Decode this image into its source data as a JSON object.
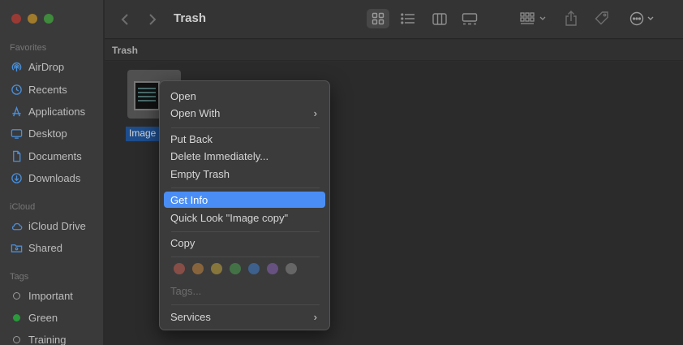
{
  "window": {
    "title": "Trash",
    "path_label": "Trash"
  },
  "sidebar": {
    "sections": [
      {
        "label": "Favorites"
      },
      {
        "label": "iCloud"
      },
      {
        "label": "Tags"
      }
    ],
    "favorites": [
      {
        "label": "AirDrop",
        "icon": "airdrop-icon"
      },
      {
        "label": "Recents",
        "icon": "clock-icon"
      },
      {
        "label": "Applications",
        "icon": "applications-icon"
      },
      {
        "label": "Desktop",
        "icon": "desktop-icon"
      },
      {
        "label": "Documents",
        "icon": "document-icon"
      },
      {
        "label": "Downloads",
        "icon": "download-icon"
      }
    ],
    "icloud": [
      {
        "label": "iCloud Drive",
        "icon": "cloud-icon"
      },
      {
        "label": "Shared",
        "icon": "shared-folder-icon"
      }
    ],
    "tags": [
      {
        "label": "Important",
        "color": "none"
      },
      {
        "label": "Green",
        "color": "#2a9a3a"
      },
      {
        "label": "Training",
        "color": "none"
      }
    ]
  },
  "file": {
    "name": "Image"
  },
  "context_menu": {
    "items": [
      {
        "label": "Open"
      },
      {
        "label": "Open With",
        "submenu": "›"
      },
      {
        "label": "Put Back"
      },
      {
        "label": "Delete Immediately..."
      },
      {
        "label": "Empty Trash"
      },
      {
        "label": "Get Info",
        "highlighted": true
      },
      {
        "label": "Quick Look \"Image copy\""
      },
      {
        "label": "Copy"
      },
      {
        "label": "Tags..."
      },
      {
        "label": "Services",
        "submenu": "›"
      }
    ],
    "tag_colors": [
      "#c45e4e",
      "#c9873c",
      "#c5a73c",
      "#4aa14e",
      "#3f7fd0",
      "#8a64b8",
      "#8a8a8a"
    ]
  },
  "colors": {
    "accent": "#4a8ef5",
    "selection": "#1d4d8c"
  }
}
